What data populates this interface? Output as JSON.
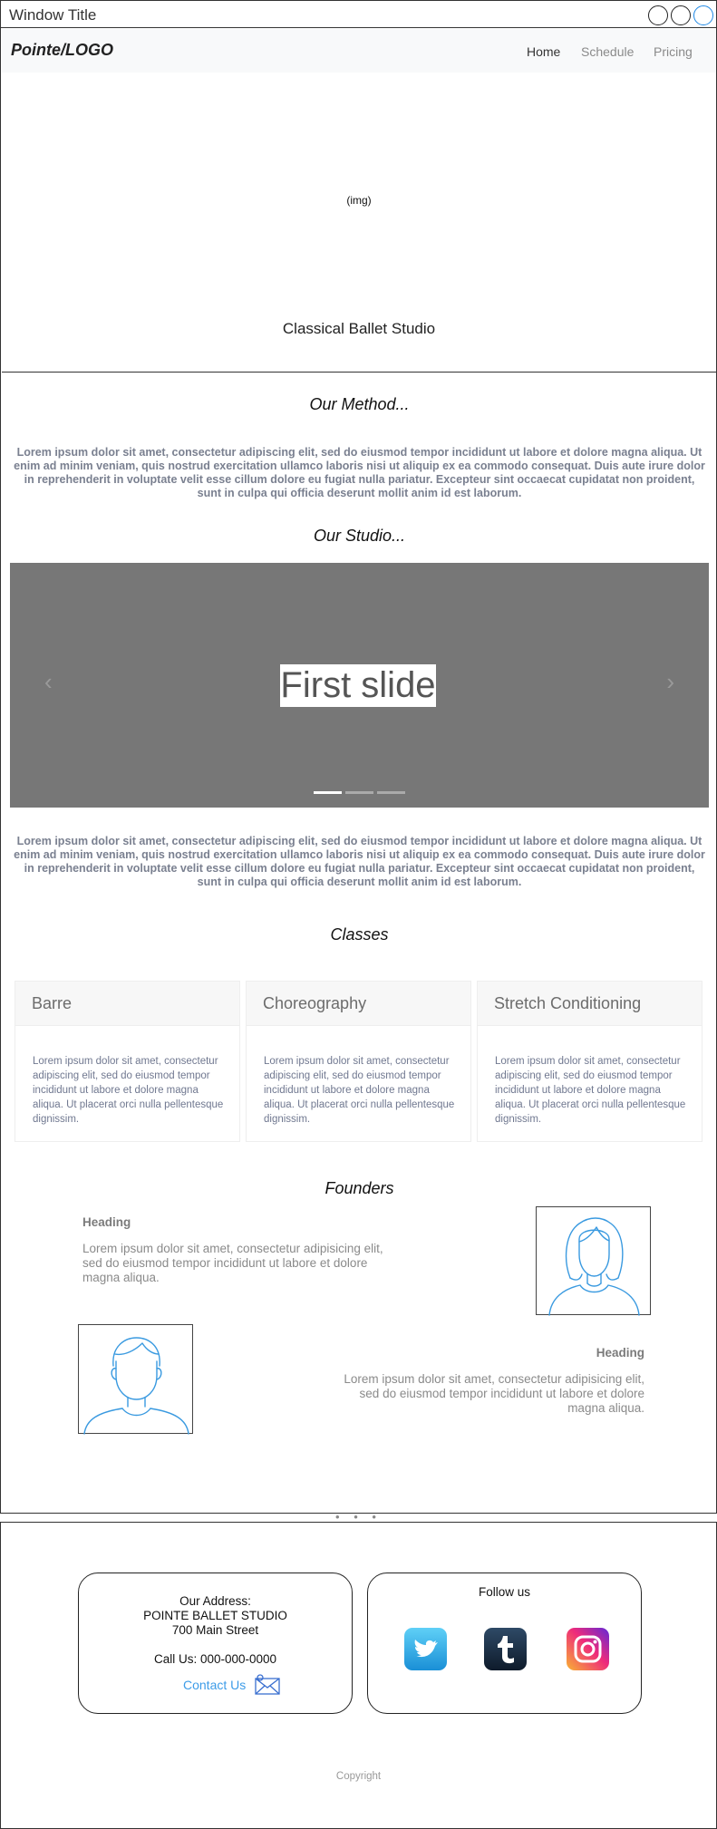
{
  "window": {
    "title": "Window Title"
  },
  "navbar": {
    "brand": "Pointe/LOGO",
    "items": [
      {
        "label": "Home",
        "active": true
      },
      {
        "label": "Schedule",
        "active": false
      },
      {
        "label": "Pricing",
        "active": false
      }
    ]
  },
  "hero": {
    "image_placeholder": "(img)",
    "caption": "Classical Ballet Studio"
  },
  "method": {
    "title": "Our Method...",
    "text": "Lorem ipsum dolor sit amet, consectetur adipiscing elit, sed do eiusmod tempor incididunt ut labore et dolore magna aliqua. Ut enim ad minim veniam, quis nostrud exercitation ullamco laboris nisi ut aliquip ex ea commodo consequat. Duis aute irure dolor in reprehenderit in voluptate velit esse cillum dolore eu fugiat nulla pariatur. Excepteur sint occaecat cupidatat non proident, sunt in culpa qui officia deserunt mollit anim id est laborum."
  },
  "studio": {
    "title": "Our Studio...",
    "carousel": {
      "slide_label": "First slide",
      "prev_icon": "‹",
      "next_icon": "›",
      "indicator_count": 3,
      "active_index": 0
    },
    "text": "Lorem ipsum dolor sit amet, consectetur adipiscing elit, sed do eiusmod tempor incididunt ut labore et dolore magna aliqua. Ut enim ad minim veniam, quis nostrud exercitation ullamco laboris nisi ut aliquip ex ea commodo consequat. Duis aute irure dolor in reprehenderit in voluptate velit esse cillum dolore eu fugiat nulla pariatur. Excepteur sint occaecat cupidatat non proident, sunt in culpa qui officia deserunt mollit anim id est laborum."
  },
  "classes": {
    "title": "Classes",
    "cards": [
      {
        "title": "Barre",
        "text": "Lorem ipsum dolor sit amet, consectetur adipiscing elit, sed do eiusmod tempor incididunt ut labore et dolore magna aliqua. Ut placerat orci nulla pellentesque dignissim."
      },
      {
        "title": "Choreography",
        "text": "Lorem ipsum dolor sit amet, consectetur adipiscing elit, sed do eiusmod tempor incididunt ut labore et dolore magna aliqua. Ut placerat orci nulla pellentesque dignissim."
      },
      {
        "title": "Stretch Conditioning",
        "text": "Lorem ipsum dolor sit amet, consectetur adipiscing elit, sed do eiusmod tempor incididunt ut labore et dolore magna aliqua. Ut placerat orci nulla pellentesque dignissim."
      }
    ]
  },
  "founders": {
    "title": "Founders",
    "items": [
      {
        "heading": "Heading",
        "text": "Lorem ipsum dolor sit amet, consectetur adipisicing elit, sed do eiusmod tempor incididunt ut labore et dolore magna aliqua.",
        "avatar_icon": "female-user-icon"
      },
      {
        "heading": "Heading",
        "text": "Lorem ipsum dolor sit amet, consectetur adipisicing elit, sed do eiusmod tempor incididunt ut labore et dolore magna aliqua.",
        "avatar_icon": "male-user-icon"
      }
    ]
  },
  "splitter": {
    "dots": "• • •"
  },
  "footer": {
    "address": {
      "label": "Our Address:",
      "name": "POINTE BALLET STUDIO",
      "street": "700 Main Street",
      "phone": "Call Us: 000-000-0000",
      "contact_link": "Contact Us",
      "mail_icon": "envelope-icon"
    },
    "follow": {
      "label": "Follow us",
      "icons": [
        "twitter-icon",
        "tumblr-icon",
        "instagram-icon"
      ]
    },
    "copyright": "Copyright"
  },
  "colors": {
    "link": "#3d9ce8",
    "carousel_bg": "#777777",
    "navbar_bg": "#f8f9fa",
    "icon_stroke": "#3a9ae0"
  }
}
